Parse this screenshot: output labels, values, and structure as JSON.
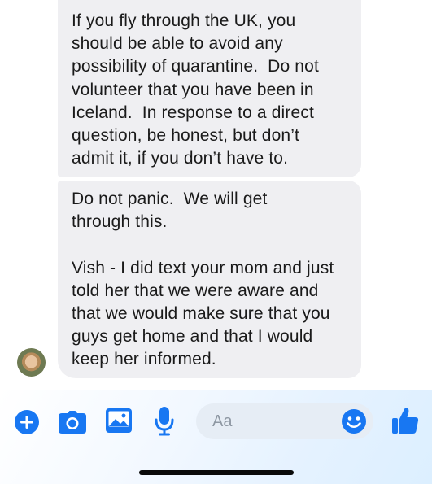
{
  "messages": [
    {
      "text": "If you fly through the UK, you\nshould be able to avoid any\npossibility of quarantine.  Do not\nvolunteer that you have been in\nIceland.  In response to a direct\nquestion, be honest, but don’t\nadmit it, if you don’t have to."
    },
    {
      "text": "Do not panic.  We will get\nthrough this.\n\nVish - I did text your mom and just\ntold her that we were aware and\nthat we would make sure that you\nguys get home and that I would\nkeep her informed."
    }
  ],
  "composer": {
    "placeholder": "Aa",
    "icons": [
      "plus-icon",
      "camera-icon",
      "gallery-icon",
      "microphone-icon",
      "emoji-icon",
      "thumbs-up-icon"
    ],
    "accent_color": "#1877f2"
  }
}
